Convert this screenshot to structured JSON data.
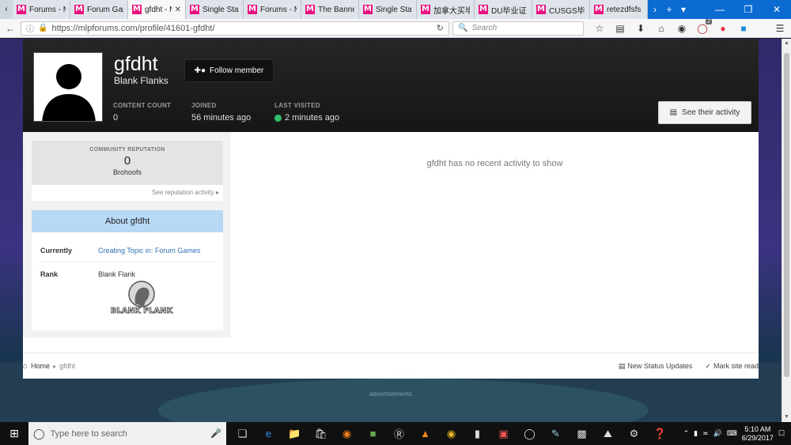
{
  "browser": {
    "tabs": [
      {
        "label": "Forums - M",
        "active": false
      },
      {
        "label": "Forum Gan",
        "active": false
      },
      {
        "label": "gfdht - M",
        "active": true
      },
      {
        "label": "Single Statu",
        "active": false
      },
      {
        "label": "Forums - M",
        "active": false
      },
      {
        "label": "The Banne",
        "active": false
      },
      {
        "label": "Single Statu",
        "active": false
      },
      {
        "label": "加拿大买毕",
        "active": false
      },
      {
        "label": "DU毕业证",
        "active": false
      },
      {
        "label": "CUSGS毕业",
        "active": false
      },
      {
        "label": "retezdfsfs",
        "active": false
      }
    ],
    "favicon_letter": "M",
    "url": "https://mlpforums.com/profile/41601-gfdht/",
    "search_placeholder": "Search",
    "ublock_badge": "2"
  },
  "profile": {
    "name": "gfdht",
    "group": "Blank Flanks",
    "follow_label": "Follow member",
    "stats": {
      "content_count_label": "CONTENT COUNT",
      "content_count": "0",
      "joined_label": "JOINED",
      "joined": "56 minutes ago",
      "last_visited_label": "LAST VISITED",
      "last_visited": "2 minutes ago"
    },
    "activity_button": "See their activity"
  },
  "reputation": {
    "title": "COMMUNITY REPUTATION",
    "value": "0",
    "unit": "Brohoofs",
    "link": "See reputation activity"
  },
  "about": {
    "title": "About gfdht",
    "currently_label": "Currently",
    "currently_value": "Creating Topic in: Forum Games",
    "rank_label": "Rank",
    "rank_value": "Blank Flank",
    "rank_badge_text": "BLANK FLANK"
  },
  "main": {
    "no_activity": "gfdht has no recent activity to show"
  },
  "footer": {
    "home": "Home",
    "current": "gfdht",
    "new_status": "New Status Updates",
    "mark_read": "Mark site read"
  },
  "ads": {
    "label": "advertisements"
  },
  "taskbar": {
    "search_placeholder": "Type here to search",
    "time": "5:10 AM",
    "date": "6/29/2017"
  },
  "colors": {
    "accent": "#0b6bd1",
    "brand_pink": "#e8117f",
    "about_header": "#b8d9f6",
    "online": "#2fbf71"
  }
}
